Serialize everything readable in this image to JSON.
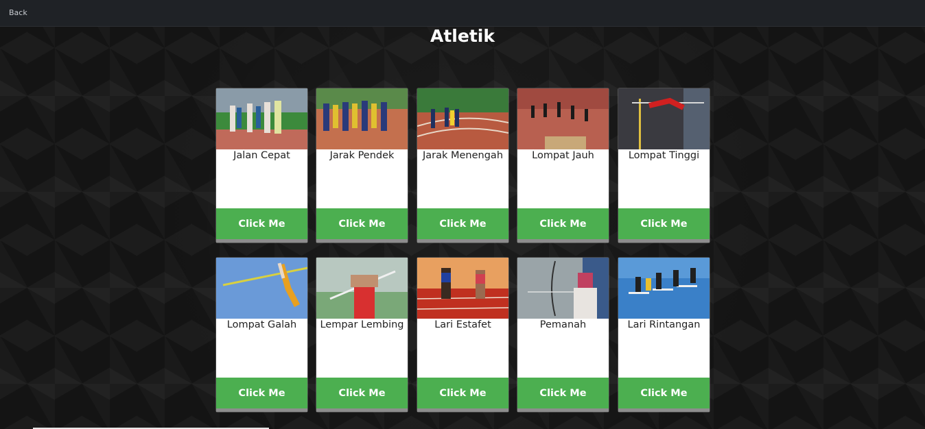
{
  "topbar": {
    "back_label": "Back"
  },
  "page": {
    "title": "Atletik"
  },
  "cards": [
    {
      "label": "Jalan Cepat",
      "button": "Click Me",
      "image": "race-walk-photo"
    },
    {
      "label": "Jarak Pendek",
      "button": "Click Me",
      "image": "sprint-photo"
    },
    {
      "label": "Jarak Menengah",
      "button": "Click Me",
      "image": "middle-distance-photo"
    },
    {
      "label": "Lompat Jauh",
      "button": "Click Me",
      "image": "long-jump-photo"
    },
    {
      "label": "Lompat Tinggi",
      "button": "Click Me",
      "image": "high-jump-photo"
    },
    {
      "label": "Lompat Galah",
      "button": "Click Me",
      "image": "pole-vault-photo"
    },
    {
      "label": "Lempar Lembing",
      "button": "Click Me",
      "image": "javelin-photo"
    },
    {
      "label": "Lari Estafet",
      "button": "Click Me",
      "image": "relay-photo"
    },
    {
      "label": "Pemanah",
      "button": "Click Me",
      "image": "archery-photo"
    },
    {
      "label": "Lari Rintangan",
      "button": "Click Me",
      "image": "hurdles-photo"
    }
  ],
  "colors": {
    "button": "#4caf50",
    "topbar": "#1f2226",
    "background": "#141414"
  }
}
